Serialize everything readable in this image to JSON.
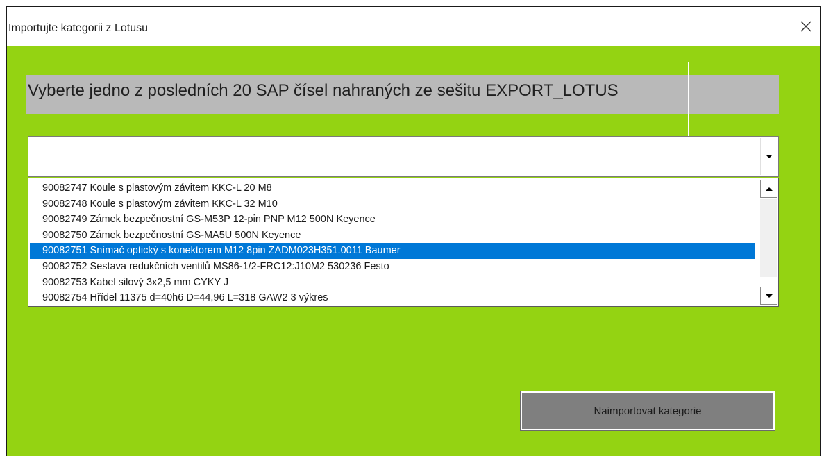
{
  "window": {
    "title": "Importujte kategorii z Lotusu",
    "close_icon": "close-icon"
  },
  "colors": {
    "client_background": "#94d312",
    "heading_background": "#b9b9b9",
    "selection": "#0078d7",
    "button": "#7f7f7f"
  },
  "heading": "Vyberte jedno z posledních 20 SAP čísel nahraných ze sešitu EXPORT_LOTUS",
  "combo": {
    "value": "",
    "arrow_icon": "chevron-down-icon"
  },
  "list": {
    "items": [
      "90082747 Koule s plastovým závitem KKC-L 20 M8",
      "90082748 Koule s plastovým závitem KKC-L 32 M10",
      "90082749 Zámek bezpečnostní GS-M53P 12-pin PNP M12 500N Keyence",
      "90082750 Zámek bezpečnostní GS-MA5U 500N Keyence",
      "90082751 Snímač optický s konektorem M12 8pin ZADM023H351.0011 Baumer",
      "90082752 Sestava redukčních ventilů MS86-1/2-FRC12:J10M2 530236 Festo",
      "90082753 Kabel silový 3x2,5 mm CYKY J",
      "90082754 Hřídel 11375 d=40h6 D=44,96 L=318 GAW2 3 výkres"
    ],
    "selected_index": 4
  },
  "import_button": "Naimportovat kategorie"
}
